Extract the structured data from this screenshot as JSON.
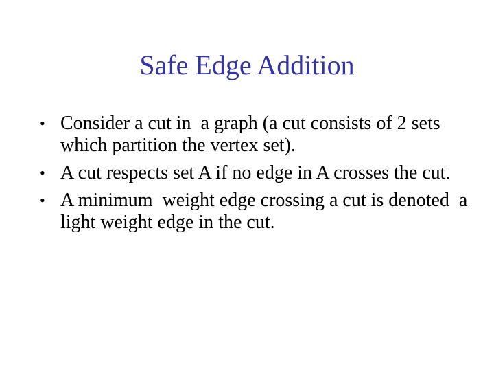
{
  "slide": {
    "title": "Safe Edge Addition",
    "title_color": "#3333a8",
    "bullet_symbol": "•",
    "bullets": [
      {
        "text": "Consider a cut in  a graph (a cut consists of 2 sets which partition the vertex set)."
      },
      {
        "text": "A cut respects set A if no edge in A crosses the cut."
      },
      {
        "text": "A minimum  weight edge crossing a cut is denoted  a light weight edge in the cut."
      }
    ]
  }
}
